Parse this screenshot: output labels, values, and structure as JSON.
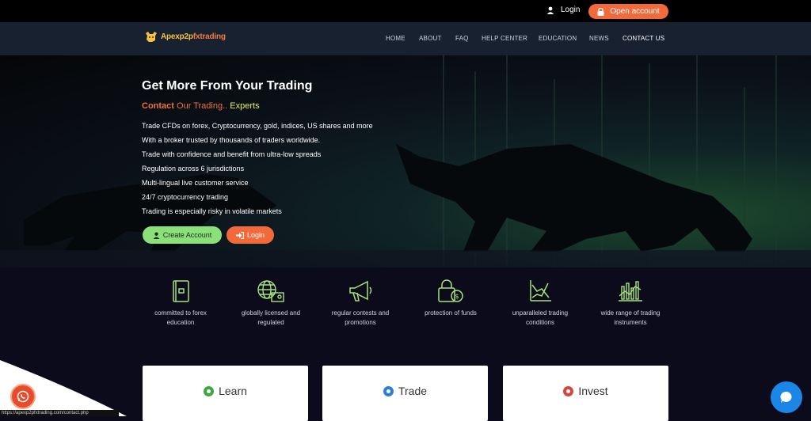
{
  "topbar": {
    "login_label": "Login",
    "open_account_label": "Open account"
  },
  "logo": {
    "part1": "Apexp2p",
    "part2": "fxtrading"
  },
  "nav": {
    "items": [
      "HOME",
      "ABOUT",
      "FAQ",
      "HELP CENTER",
      "EDUCATION",
      "NEWS",
      "CONTACT US"
    ],
    "active": "CONTACT US"
  },
  "hero": {
    "title": "Get More From Your Trading",
    "subtitle_contact": "Contact",
    "subtitle_trading": "Our Trading..",
    "subtitle_experts": "Experts",
    "lines": [
      "Trade CFDs on forex, Cryptocurrency, gold, indices, US shares and more",
      "With a broker trusted by thousands of traders worldwide.",
      "Trade with confidence and benefit from ultra-low spreads",
      "Regulation across 6 jurisdictions",
      "Multi-lingual live customer service",
      "24/7 cryptocurrency trading",
      "Trading is especially risky in volatile markets"
    ],
    "create_account_label": "Create Account",
    "login_label": "Login"
  },
  "features": [
    {
      "icon": "book-icon",
      "label1": "committed to forex",
      "label2": "education"
    },
    {
      "icon": "globe-certificate-icon",
      "label1": "globally licensed and",
      "label2": "regulated"
    },
    {
      "icon": "megaphone-icon",
      "label1": "regular contests and",
      "label2": "promotions"
    },
    {
      "icon": "money-lock-icon",
      "label1": "protection of funds",
      "label2": ""
    },
    {
      "icon": "growth-chart-icon",
      "label1": "unparalleled trading",
      "label2": "conditions"
    },
    {
      "icon": "instruments-chart-icon",
      "label1": "wide range of trading",
      "label2": "instruments"
    }
  ],
  "cards": [
    {
      "title": "Learn",
      "color": "#3fa742"
    },
    {
      "title": "Trade",
      "color": "#2f7ddb"
    },
    {
      "title": "Invest",
      "color": "#d9443c"
    }
  ],
  "status_url": "https://apexp2pfxtrading.com/contact.php",
  "colors": {
    "accent_orange": "#f26a3c",
    "accent_green": "#8ce07a",
    "icon_green": "#a6e37a",
    "navbar": "#182130"
  }
}
